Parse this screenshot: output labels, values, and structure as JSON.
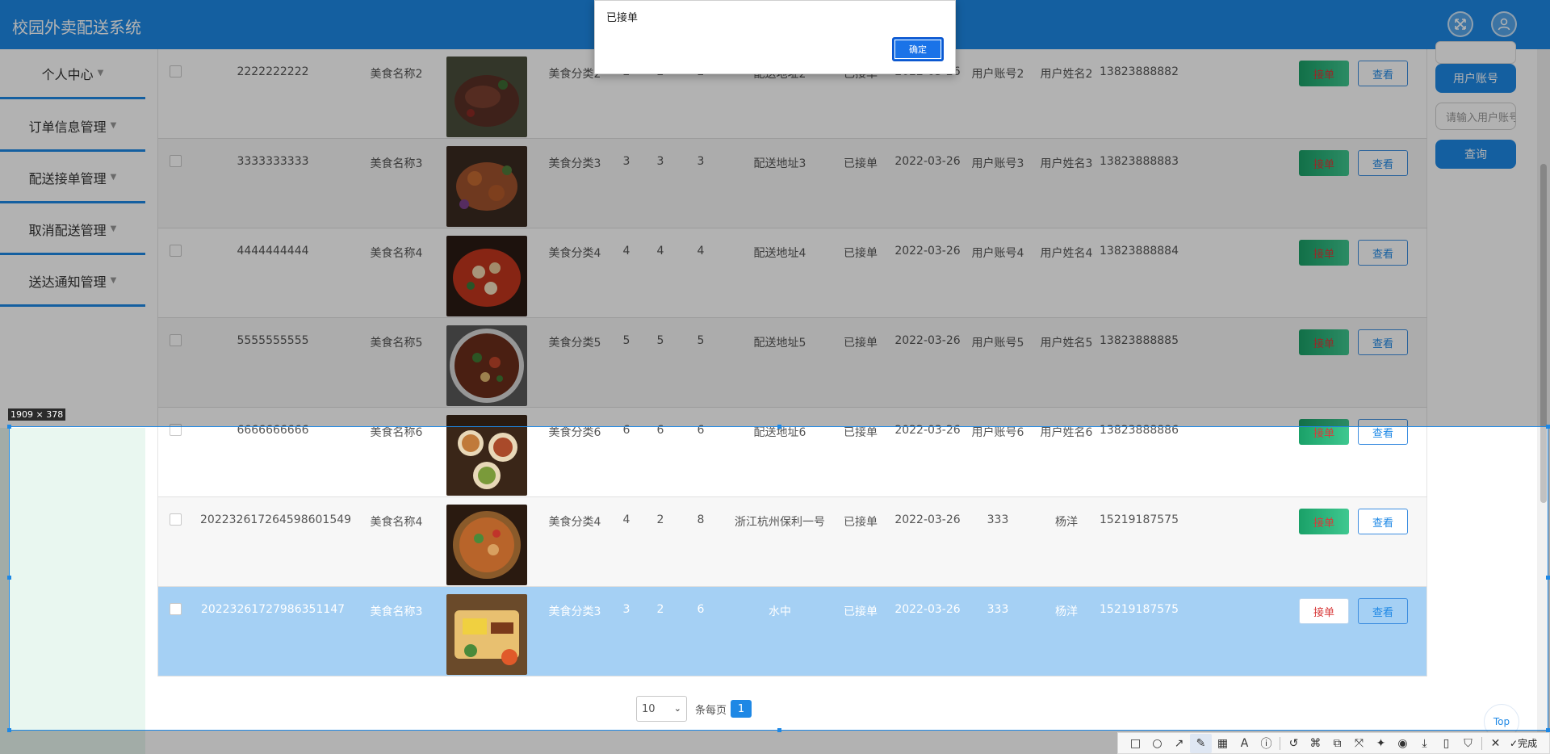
{
  "app": {
    "title": "校园外卖配送系统"
  },
  "sidebar": {
    "items": [
      {
        "label": "个人中心",
        "icon": "caret-down-icon"
      },
      {
        "label": "订单信息管理",
        "icon": "caret-down-icon"
      },
      {
        "label": "配送接单管理",
        "icon": "caret-down-icon"
      },
      {
        "label": "取消配送管理",
        "icon": "caret-down-icon"
      },
      {
        "label": "送达通知管理",
        "icon": "caret-down-icon"
      }
    ]
  },
  "table": {
    "rows": [
      {
        "order_no": "2222222222",
        "food": "美食名称2",
        "category": "美食分类2",
        "qty": "2",
        "price": "2",
        "total": "2",
        "address": "配送地址2",
        "status": "已接单",
        "date": "2022-03-26",
        "account": "用户账号2",
        "name": "用户姓名2",
        "phone": "13823888882"
      },
      {
        "order_no": "3333333333",
        "food": "美食名称3",
        "category": "美食分类3",
        "qty": "3",
        "price": "3",
        "total": "3",
        "address": "配送地址3",
        "status": "已接单",
        "date": "2022-03-26",
        "account": "用户账号3",
        "name": "用户姓名3",
        "phone": "13823888883"
      },
      {
        "order_no": "4444444444",
        "food": "美食名称4",
        "category": "美食分类4",
        "qty": "4",
        "price": "4",
        "total": "4",
        "address": "配送地址4",
        "status": "已接单",
        "date": "2022-03-26",
        "account": "用户账号4",
        "name": "用户姓名4",
        "phone": "13823888884"
      },
      {
        "order_no": "5555555555",
        "food": "美食名称5",
        "category": "美食分类5",
        "qty": "5",
        "price": "5",
        "total": "5",
        "address": "配送地址5",
        "status": "已接单",
        "date": "2022-03-26",
        "account": "用户账号5",
        "name": "用户姓名5",
        "phone": "13823888885"
      },
      {
        "order_no": "6666666666",
        "food": "美食名称6",
        "category": "美食分类6",
        "qty": "6",
        "price": "6",
        "total": "6",
        "address": "配送地址6",
        "status": "已接单",
        "date": "2022-03-26",
        "account": "用户账号6",
        "name": "用户姓名6",
        "phone": "13823888886"
      },
      {
        "order_no": "202232617264598601549",
        "food": "美食名称4",
        "category": "美食分类4",
        "qty": "4",
        "price": "2",
        "total": "8",
        "address": "浙江杭州保利一号",
        "status": "已接单",
        "date": "2022-03-26",
        "account": "333",
        "name": "杨洋",
        "phone": "15219187575"
      },
      {
        "order_no": "20223261727986351147",
        "food": "美食名称3",
        "category": "美食分类3",
        "qty": "3",
        "price": "2",
        "total": "6",
        "address": "水中",
        "status": "已接单",
        "date": "2022-03-26",
        "account": "333",
        "name": "杨洋",
        "phone": "15219187575"
      }
    ],
    "accept_label": "接单",
    "view_label": "查看"
  },
  "right_panel": {
    "account_button": "用户账号",
    "account_placeholder": "请输入用户账号",
    "query_button": "查询"
  },
  "pagination": {
    "page_size": "10",
    "per_page_label": "条每页",
    "current_page": "1"
  },
  "top_button": "Top",
  "dialog": {
    "message": "已接单",
    "ok_label": "确定"
  },
  "selection": {
    "size_label": "1909 × 378"
  },
  "toolbar": {
    "done_label": "完成"
  },
  "colors": {
    "header": "#1e88e5",
    "accept_button": "#1aa168",
    "accept_text": "#d83a3a",
    "selected_row": "#a5d0f4"
  }
}
